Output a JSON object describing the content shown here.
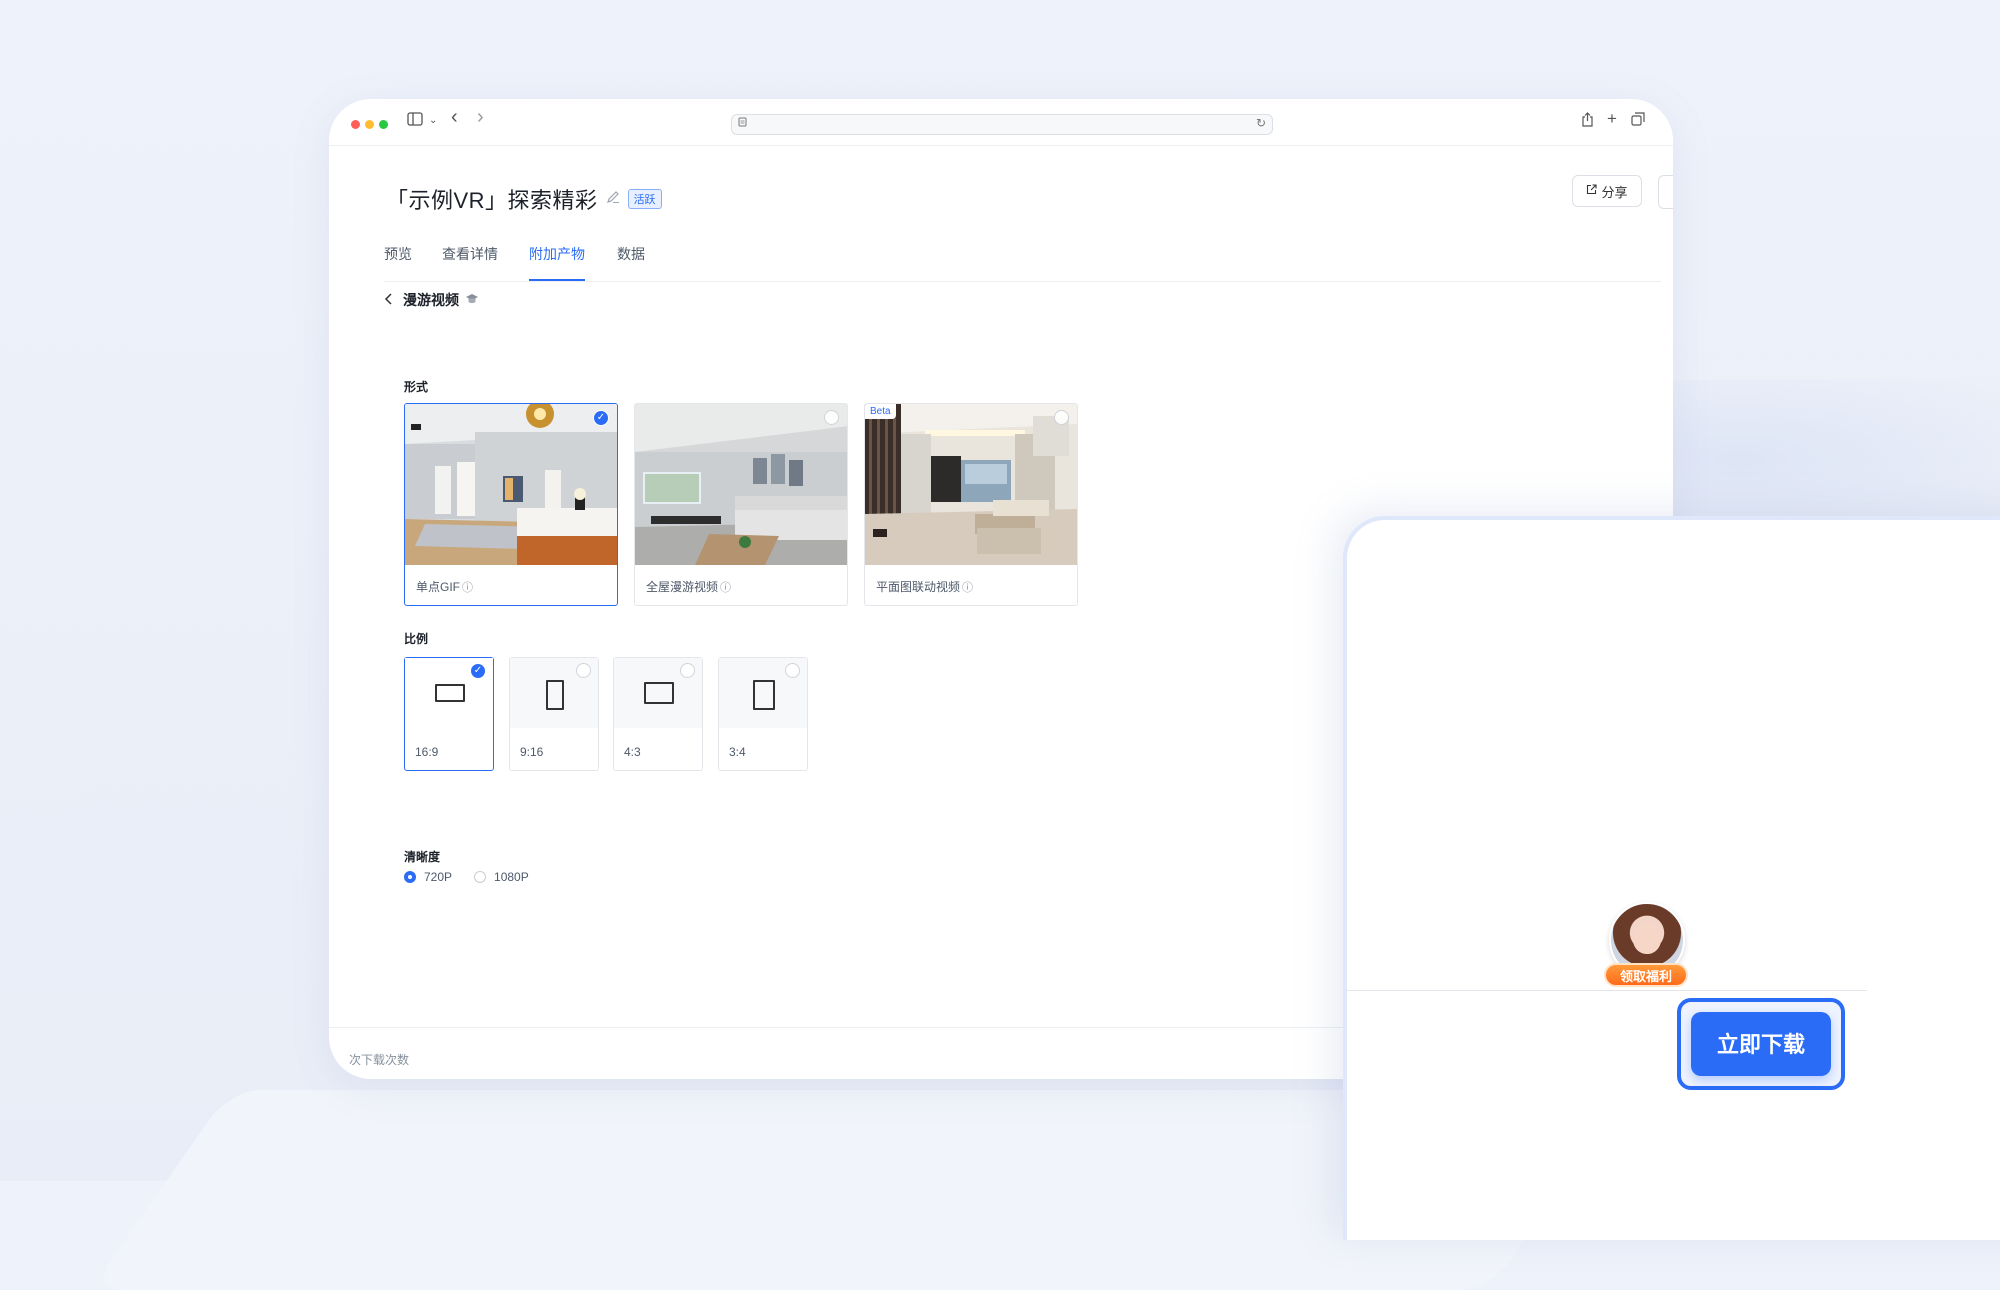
{
  "browser": {
    "nav_back": "‹",
    "nav_forward": "›"
  },
  "header": {
    "title": "「示例VR」探索精彩",
    "badge": "活跃",
    "share_label": "分享"
  },
  "tabs": [
    {
      "label": "预览",
      "active": false
    },
    {
      "label": "查看详情",
      "active": false
    },
    {
      "label": "附加产物",
      "active": true
    },
    {
      "label": "数据",
      "active": false
    }
  ],
  "section": {
    "title": "漫游视频"
  },
  "form": {
    "label": "形式",
    "options": [
      {
        "label": "单点GIF",
        "selected": true,
        "beta": false
      },
      {
        "label": "全屋漫游视频",
        "selected": false,
        "beta": false
      },
      {
        "label": "平面图联动视频",
        "selected": false,
        "beta": true,
        "beta_label": "Beta"
      }
    ]
  },
  "ratio": {
    "label": "比例",
    "options": [
      {
        "label": "16:9",
        "selected": true
      },
      {
        "label": "9:16",
        "selected": false
      },
      {
        "label": "4:3",
        "selected": false
      },
      {
        "label": "3:4",
        "selected": false
      }
    ]
  },
  "resolution": {
    "label": "清晰度",
    "options": [
      {
        "label": "720P",
        "selected": true
      },
      {
        "label": "1080P",
        "selected": false
      }
    ]
  },
  "footer": {
    "text": "次下载次数"
  },
  "panel": {
    "gift_label": "领取福利",
    "download_label": "立即下载"
  },
  "colors": {
    "accent": "#2b6cf6",
    "gift": "#ff7a26"
  }
}
